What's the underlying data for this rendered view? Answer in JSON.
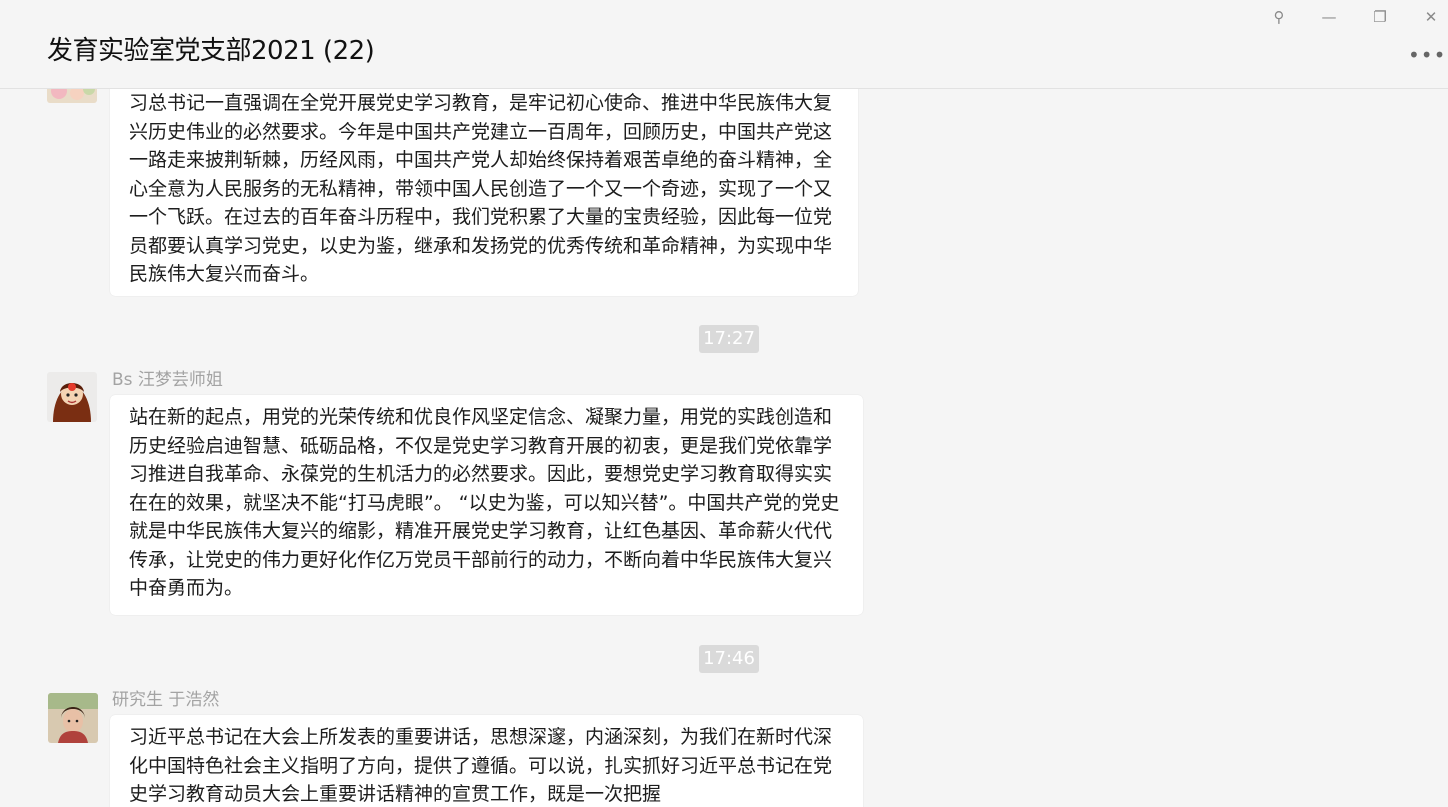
{
  "window": {
    "title": "发育实验室党支部2021 (22)",
    "controls": {
      "pin_icon": "pin-icon",
      "minimize_icon": "minimize-icon",
      "restore_icon": "restore-icon",
      "close_icon": "close-icon",
      "pin_glyph": "⚲",
      "minimize_glyph": "—",
      "restore_glyph": "❐",
      "close_glyph": "✕"
    },
    "more_glyph": "•••"
  },
  "messages": [
    {
      "sender": "",
      "avatar": "avatar-flowers",
      "text": "习总书记一直强调在全党开展党史学习教育，是牢记初心使命、推进中华民族伟大复兴历史伟业的必然要求。今年是中国共产党建立一百周年，回顾历史，中国共产党这一路走来披荆斩棘，历经风雨，中国共产党人却始终保持着艰苦卓绝的奋斗精神，全心全意为人民服务的无私精神，带领中国人民创造了一个又一个奇迹，实现了一个又一个飞跃。在过去的百年奋斗历程中，我们党积累了大量的宝贵经验，因此每一位党员都要认真学习党史，以史为鉴，继承和发扬党的优秀传统和革命精神，为实现中华民族伟大复兴而奋斗。"
    },
    {
      "time": "17:27",
      "sender": "Bs 汪梦芸师姐",
      "avatar": "avatar-cartoon",
      "text": "站在新的起点，用党的光荣传统和优良作风坚定信念、凝聚力量，用党的实践创造和历史经验启迪智慧、砥砺品格，不仅是党史学习教育开展的初衷，更是我们党依靠学习推进自我革命、永葆党的生机活力的必然要求。因此，要想党史学习教育取得实实在在的效果，就坚决不能“打马虎眼”。 “以史为鉴，可以知兴替”。中国共产党的党史就是中华民族伟大复兴的缩影，精准开展党史学习教育，让红色基因、革命薪火代代传承，让党史的伟力更好化作亿万党员干部前行的动力，不断向着中华民族伟大复兴中奋勇而为。"
    },
    {
      "time": "17:46",
      "sender": "研究生 于浩然",
      "avatar": "avatar-photo",
      "text": "习近平总书记在大会上所发表的重要讲话，思想深邃，内涵深刻，为我们在新时代深化中国特色社会主义指明了方向，提供了遵循。可以说，扎实抓好习近平总书记在党史学习教育动员大会上重要讲话精神的宣贯工作，既是一次把握"
    }
  ]
}
